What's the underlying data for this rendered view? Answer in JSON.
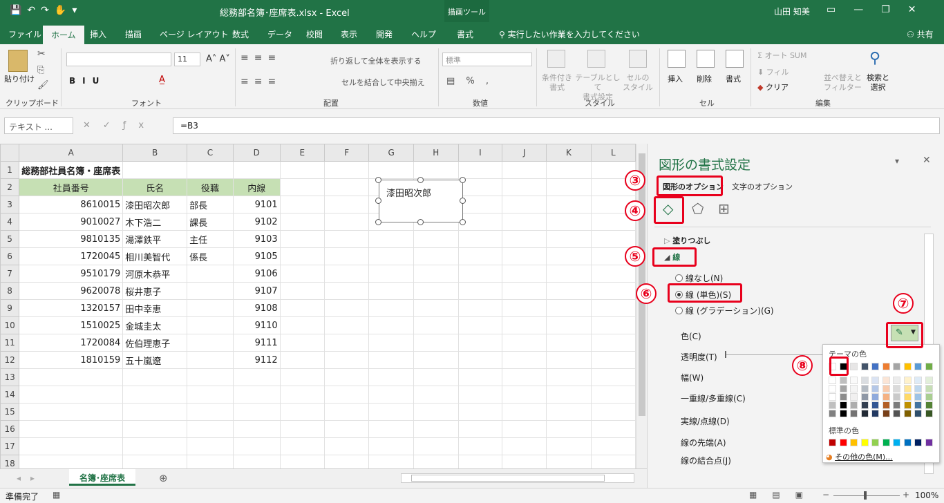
{
  "titlebar": {
    "filename": "総務部名簿･座席表.xlsx  -  Excel",
    "context_tool": "描画ツール",
    "user": "山田 知美"
  },
  "tabs": [
    "ファイル",
    "ホーム",
    "挿入",
    "描画",
    "ページ レイアウト",
    "数式",
    "データ",
    "校閲",
    "表示",
    "開発",
    "ヘルプ",
    "書式"
  ],
  "tellme": "実行したい作業を入力してください",
  "share": "共有",
  "ribbon": {
    "paste": "貼り付け",
    "groups": [
      "クリップボード",
      "フォント",
      "配置",
      "数値",
      "スタイル",
      "セル",
      "編集"
    ],
    "font_size": "11",
    "wrap_text": "折り返して全体を表示する",
    "merge_center": "セルを結合して中央揃え",
    "number_format": "標準",
    "cond_format": [
      "条件付き",
      "書式"
    ],
    "table_format": [
      "テーブルとして",
      "書式設定"
    ],
    "cell_style": [
      "セルの",
      "スタイル"
    ],
    "insert": "挿入",
    "delete": "削除",
    "format": "書式",
    "autosum": "オート SUM",
    "fill": "フィル",
    "clear": "クリア",
    "sort": [
      "並べ替えと",
      "フィルター"
    ],
    "find": [
      "検索と",
      "選択"
    ]
  },
  "formula_bar": {
    "name_box": "テキスト ...",
    "formula": "=B3"
  },
  "columns": [
    "A",
    "B",
    "C",
    "D",
    "E",
    "F",
    "G",
    "H",
    "I",
    "J",
    "K",
    "L"
  ],
  "rows": [
    {
      "n": "1",
      "a": "総務部社員名簿・座席表",
      "b": "",
      "c": "",
      "d": ""
    },
    {
      "n": "2",
      "a": "社員番号",
      "b": "氏名",
      "c": "役職",
      "d": "内線"
    },
    {
      "n": "3",
      "a": "8610015",
      "b": "漆田昭次郎",
      "c": "部長",
      "d": "9101"
    },
    {
      "n": "4",
      "a": "9010027",
      "b": "木下浩二",
      "c": "課長",
      "d": "9102"
    },
    {
      "n": "5",
      "a": "9810135",
      "b": "湯澤鉄平",
      "c": "主任",
      "d": "9103"
    },
    {
      "n": "6",
      "a": "1720045",
      "b": "相川美智代",
      "c": "係長",
      "d": "9105"
    },
    {
      "n": "7",
      "a": "9510179",
      "b": "河原木恭平",
      "c": "",
      "d": "9106"
    },
    {
      "n": "8",
      "a": "9620078",
      "b": "桜井恵子",
      "c": "",
      "d": "9107"
    },
    {
      "n": "9",
      "a": "1320157",
      "b": "田中幸恵",
      "c": "",
      "d": "9108"
    },
    {
      "n": "10",
      "a": "1510025",
      "b": "金城圭太",
      "c": "",
      "d": "9110"
    },
    {
      "n": "11",
      "a": "1720084",
      "b": "佐伯理恵子",
      "c": "",
      "d": "9111"
    },
    {
      "n": "12",
      "a": "1810159",
      "b": "五十嵐遼",
      "c": "",
      "d": "9112"
    },
    {
      "n": "13",
      "a": "",
      "b": "",
      "c": "",
      "d": ""
    },
    {
      "n": "14",
      "a": "",
      "b": "",
      "c": "",
      "d": ""
    },
    {
      "n": "15",
      "a": "",
      "b": "",
      "c": "",
      "d": ""
    },
    {
      "n": "16",
      "a": "",
      "b": "",
      "c": "",
      "d": ""
    },
    {
      "n": "17",
      "a": "",
      "b": "",
      "c": "",
      "d": ""
    },
    {
      "n": "18",
      "a": "",
      "b": "",
      "c": "",
      "d": ""
    }
  ],
  "shape_text": "漆田昭次郎",
  "sheet_tab": "名簿･座席表",
  "status": {
    "ready": "準備完了",
    "zoom": "100%"
  },
  "pane": {
    "title": "図形の書式設定",
    "tab_shape": "図形のオプション",
    "tab_text": "文字のオプション",
    "fill": "塗りつぶし",
    "line": "線",
    "no_line": "線なし(N)",
    "solid_line": "線 (単色)(S)",
    "gradient_line": "線 (グラデーション)(G)",
    "color": "色(C)",
    "transparency": "透明度(T)",
    "width": "幅(W)",
    "compound": "一重線/多重線(C)",
    "dash": "実線/点線(D)",
    "cap": "線の先端(A)",
    "join": "線の結合点(J)"
  },
  "palette": {
    "theme_label": "テーマの色",
    "standard_label": "標準の色",
    "more_colors": "その他の色(M)...",
    "theme_colors": [
      "#ffffff",
      "#000000",
      "#e7e6e6",
      "#44546a",
      "#4472c4",
      "#ed7d31",
      "#a5a5a5",
      "#ffc000",
      "#5b9bd5",
      "#70ad47"
    ],
    "standard_colors": [
      "#c00000",
      "#ff0000",
      "#ffc000",
      "#ffff00",
      "#92d050",
      "#00b050",
      "#00b0f0",
      "#0070c0",
      "#002060",
      "#7030a0"
    ]
  },
  "markers": [
    "③",
    "④",
    "⑤",
    "⑥",
    "⑦",
    "⑧"
  ]
}
